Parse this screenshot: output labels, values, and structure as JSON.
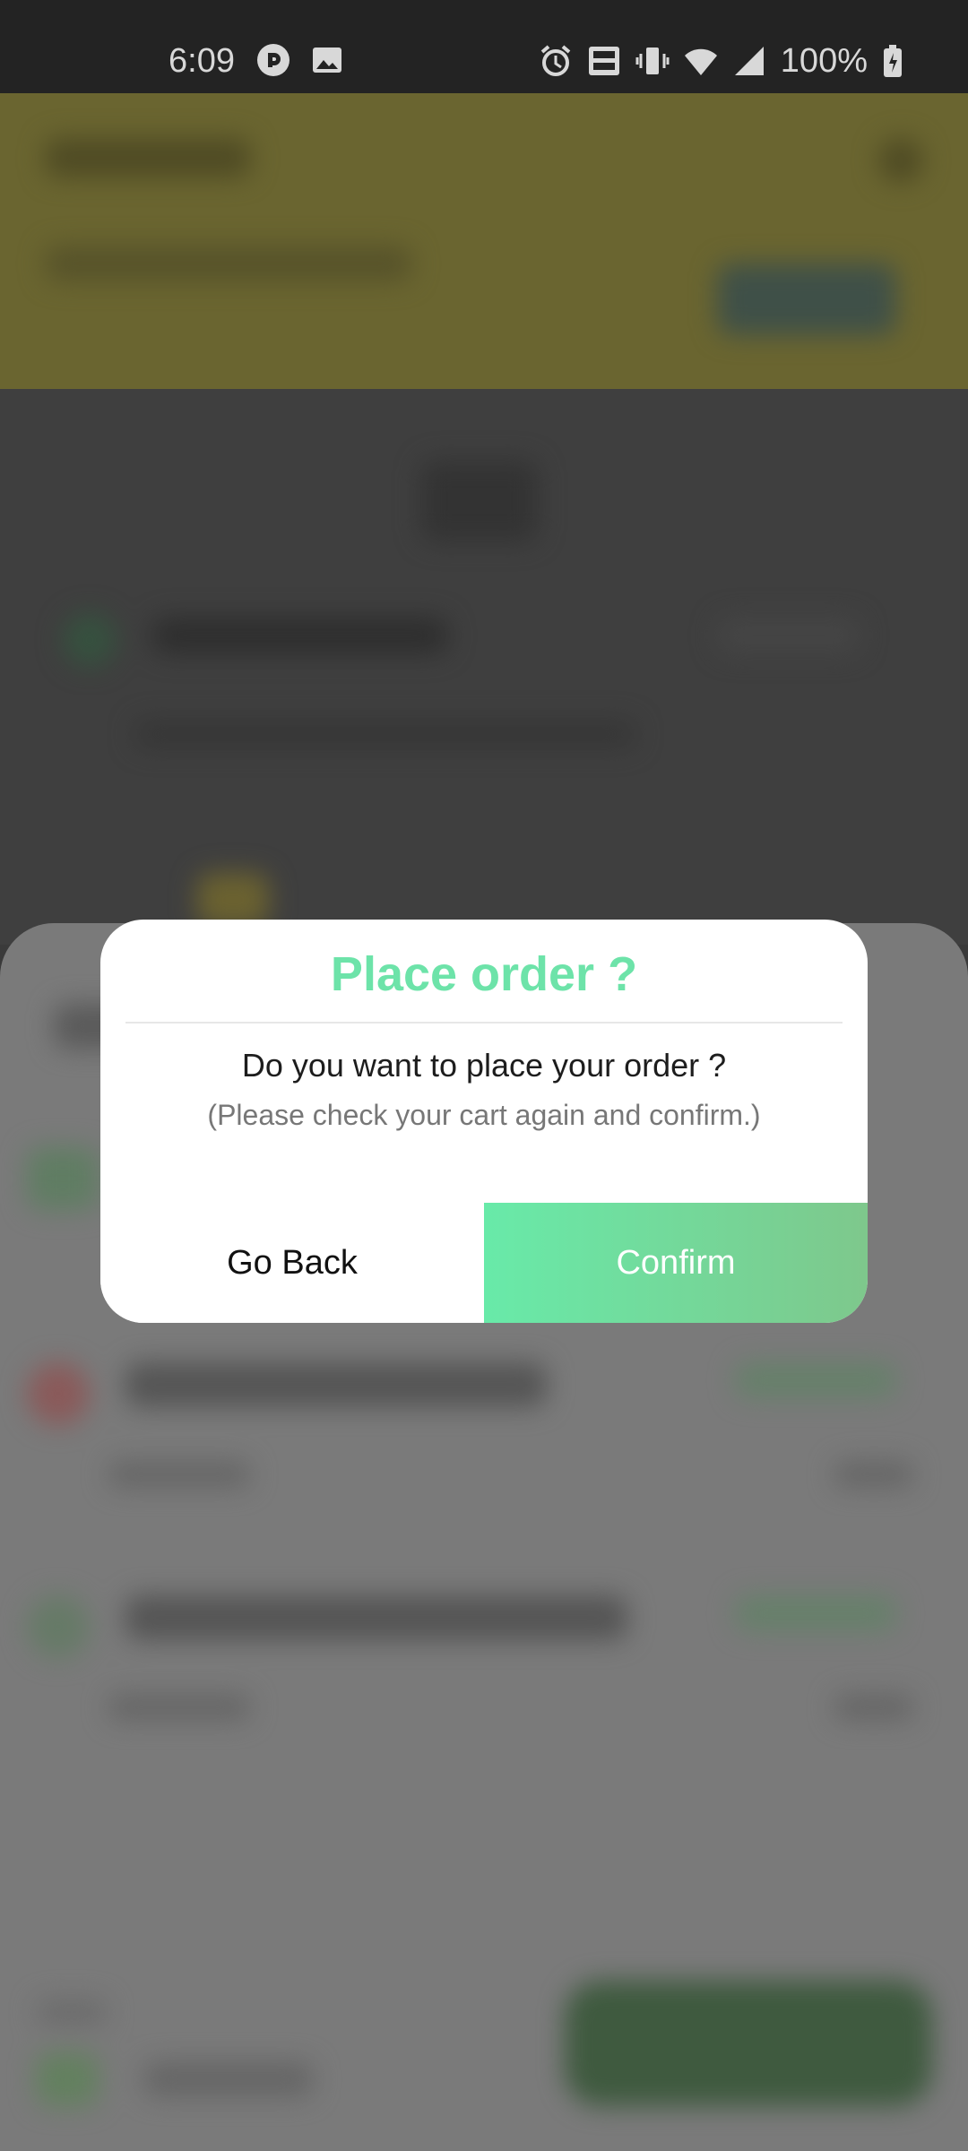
{
  "status_bar": {
    "time": "6:09",
    "battery": "100%",
    "icons": [
      "messenger-icon",
      "image-icon",
      "alarm-icon",
      "volte-icon",
      "vibrate-icon",
      "wifi-icon",
      "signal-icon",
      "battery-icon"
    ]
  },
  "dialog": {
    "title": "Place order ?",
    "message": "Do you want to place your order ?",
    "submessage": "(Please check your cart again and confirm.)",
    "back_label": "Go Back",
    "confirm_label": "Confirm"
  },
  "colors": {
    "accent": "#6de3a9",
    "confirm_gradient_start": "#68eaa9",
    "confirm_gradient_end": "#7ec88c",
    "scrim": "#3a3a3a"
  }
}
